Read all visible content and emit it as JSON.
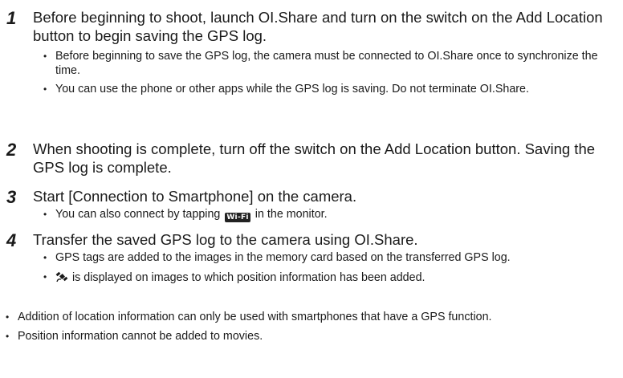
{
  "steps": [
    {
      "number": "1",
      "text": "Before beginning to shoot, launch OI.Share and turn on the switch on the Add Location button to begin saving the GPS log.",
      "bullets": [
        "Before beginning to save the GPS log, the camera must be connected to OI.Share once to synchronize the time.",
        "You can use the phone or other apps while the GPS log is saving. Do not terminate OI.Share."
      ]
    },
    {
      "number": "2",
      "text": "When shooting is complete, turn off the switch on the Add Location button. Saving the GPS log is complete."
    },
    {
      "number": "3",
      "text": "Start [Connection to Smartphone] on the camera.",
      "bullet_before": "You can also connect by tapping",
      "bullet_icon": "Wi-Fi",
      "bullet_after": "in the monitor."
    },
    {
      "number": "4",
      "text": "Transfer the saved GPS log to the camera using OI.Share.",
      "bullets": [
        "GPS tags are added to the images in the memory card based on the transferred GPS log."
      ],
      "icon_bullet_icon": "gps-satellite-icon",
      "icon_bullet_text": "is displayed on images to which position information has been added."
    }
  ],
  "notes": [
    "Addition of location information can only be used with smartphones that have a GPS function.",
    "Position information cannot be added to movies."
  ]
}
